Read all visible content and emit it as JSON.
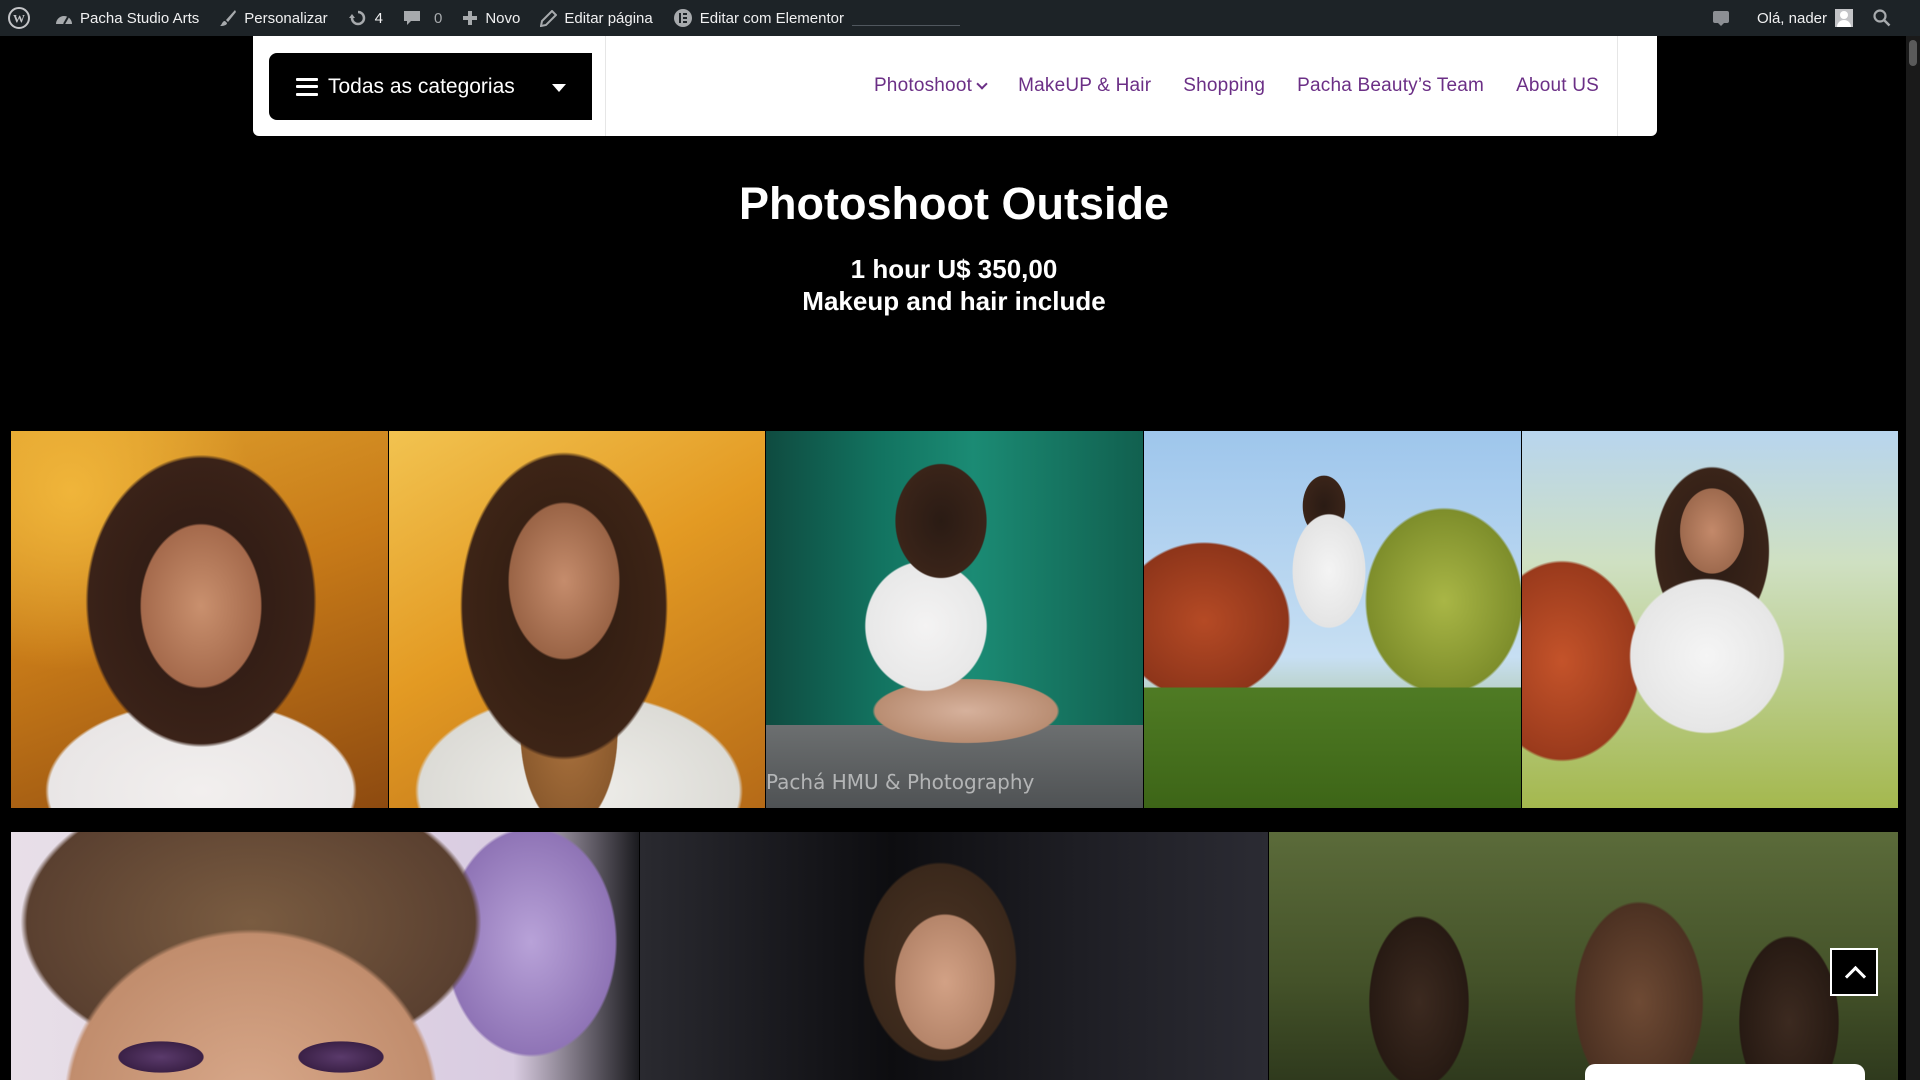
{
  "adminbar": {
    "site_name": "Pacha Studio Arts",
    "customize": "Personalizar",
    "updates_count": "4",
    "comments_count": "0",
    "new": "Novo",
    "edit_page": "Editar página",
    "edit_elementor": "Editar com Elementor",
    "greeting": "Olá, nader"
  },
  "header": {
    "categories_label": "Todas as categorias",
    "nav": [
      "Photoshoot",
      "MakeUP & Hair",
      "Shopping",
      "Pacha Beauty’s Team",
      "About US"
    ]
  },
  "page": {
    "title": "Photoshoot Outside",
    "subtitle_line1": "1 hour U$ 350,00",
    "subtitle_line2": "Makeup and hair include"
  },
  "gallery": {
    "watermark": "Pachá HMU & Photography"
  },
  "colors": {
    "adminbar_bg": "#1d2327",
    "page_bg": "#000000",
    "nav_text": "#6b2f86"
  }
}
